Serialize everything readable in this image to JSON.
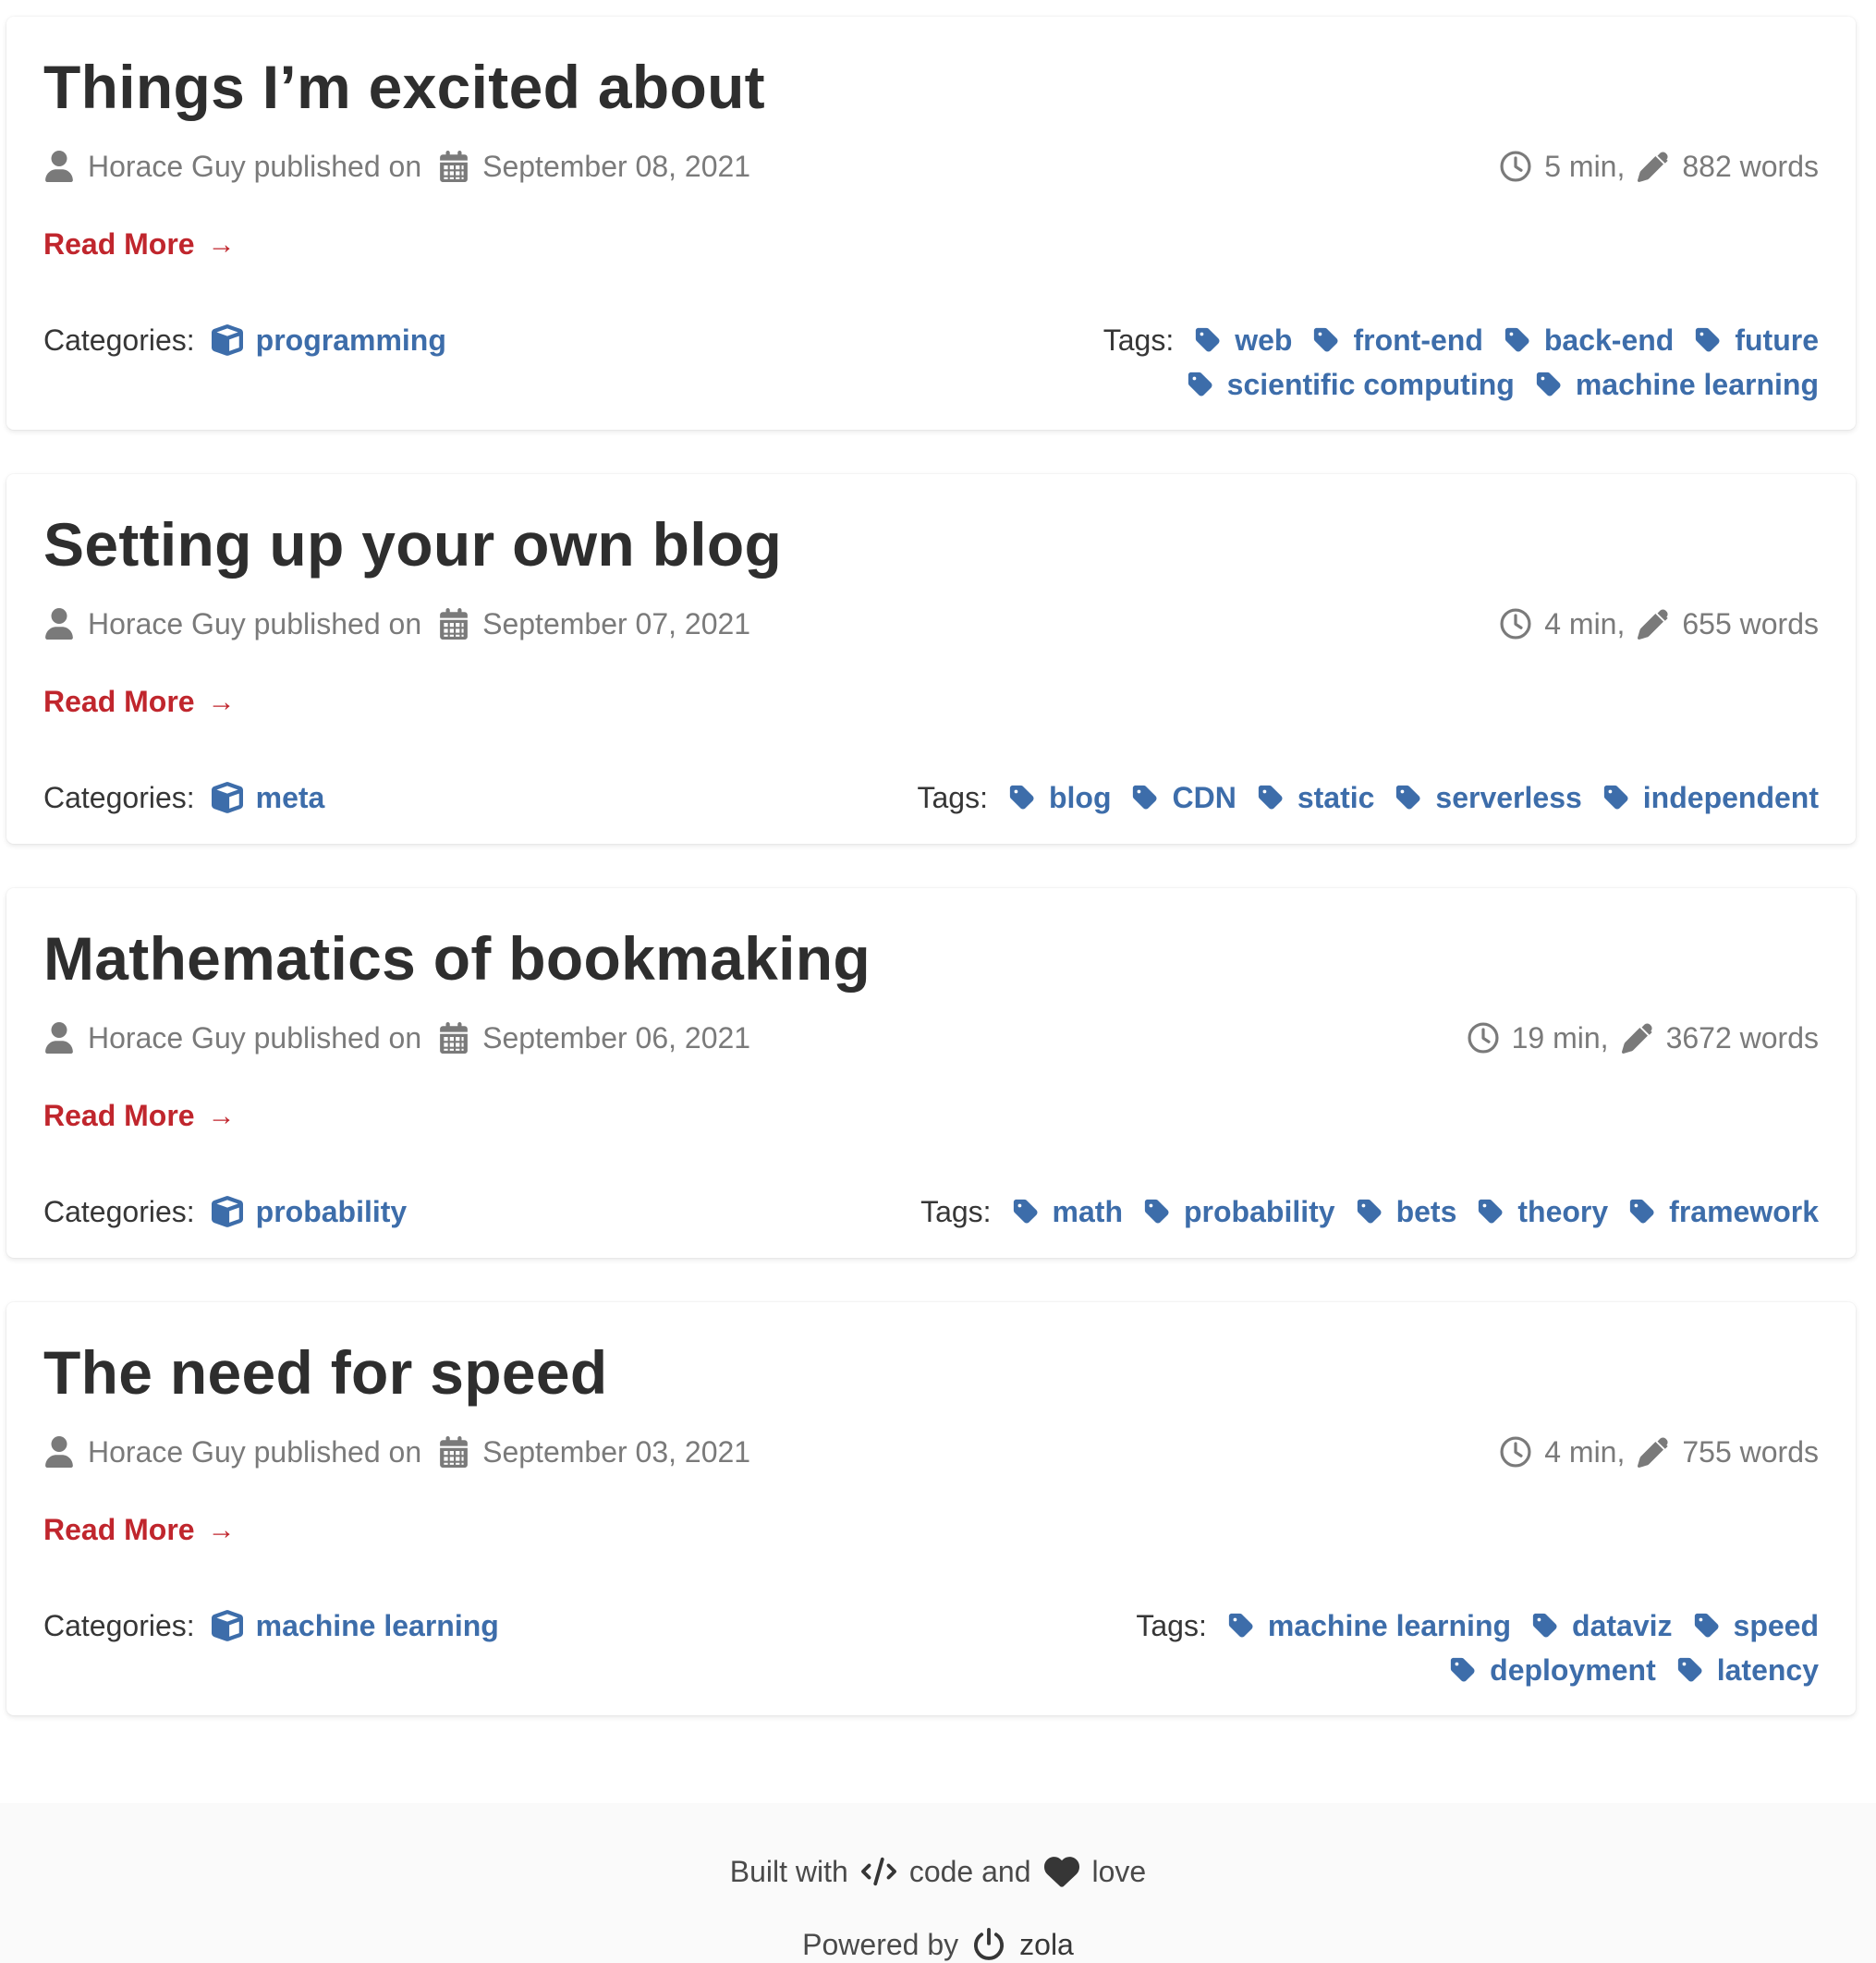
{
  "posts": [
    {
      "title": "Things I’m excited about",
      "author": "Horace Guy",
      "published_on": "published on",
      "date": "September 08, 2021",
      "read_time": "5 min,",
      "words": "882 words",
      "read_more": "Read More",
      "categories_label": "Categories:",
      "category": "programming",
      "tags_label": "Tags:",
      "tag_rows": [
        [
          "web",
          "front-end",
          "back-end",
          "future"
        ],
        [
          "scientific computing",
          "machine learning"
        ]
      ]
    },
    {
      "title": "Setting up your own blog",
      "author": "Horace Guy",
      "published_on": "published on",
      "date": "September 07, 2021",
      "read_time": "4 min,",
      "words": "655 words",
      "read_more": "Read More",
      "categories_label": "Categories:",
      "category": "meta",
      "tags_label": "Tags:",
      "tag_rows": [
        [
          "blog",
          "CDN",
          "static",
          "serverless",
          "independent"
        ]
      ]
    },
    {
      "title": "Mathematics of bookmaking",
      "author": "Horace Guy",
      "published_on": "published on",
      "date": "September 06, 2021",
      "read_time": "19 min,",
      "words": "3672 words",
      "read_more": "Read More",
      "categories_label": "Categories:",
      "category": "probability",
      "tags_label": "Tags:",
      "tag_rows": [
        [
          "math",
          "probability",
          "bets",
          "theory",
          "framework"
        ]
      ]
    },
    {
      "title": "The need for speed",
      "author": "Horace Guy",
      "published_on": "published on",
      "date": "September 03, 2021",
      "read_time": "4 min,",
      "words": "755 words",
      "read_more": "Read More",
      "categories_label": "Categories:",
      "category": "machine learning",
      "tags_label": "Tags:",
      "tag_rows": [
        [
          "machine learning",
          "dataviz",
          "speed"
        ],
        [
          "deployment",
          "latency"
        ]
      ]
    }
  ],
  "footer": {
    "built_with": "Built with",
    "code_and": "code and",
    "love": "love",
    "powered_by": "Powered by",
    "engine": "zola"
  },
  "colors": {
    "accent": "#c0262d",
    "link": "#3d6daa",
    "meta": "#7a7a7a",
    "text": "#363636"
  },
  "icons": {
    "author": "user-icon",
    "date": "calendar-icon",
    "time": "clock-icon",
    "words": "pencil-icon",
    "category": "cube-icon",
    "tag": "tag-icon"
  }
}
